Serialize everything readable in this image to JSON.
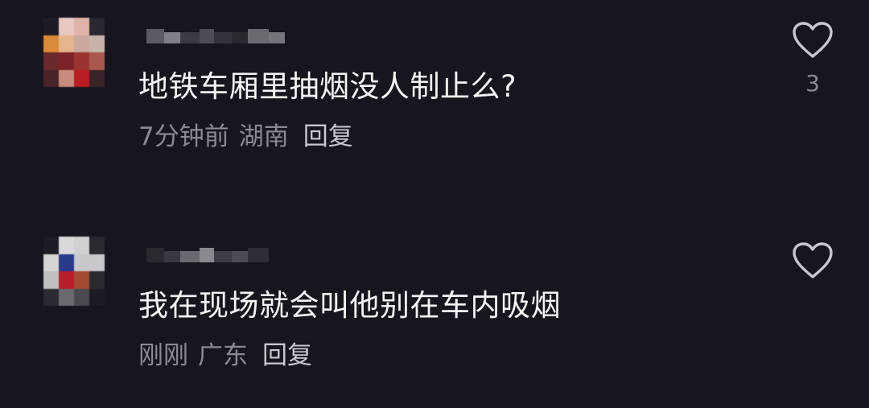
{
  "comments": [
    {
      "text": "地铁车厢里抽烟没人制止么?",
      "time": "7分钟前",
      "location": "湖南",
      "reply_label": "回复",
      "like_count": "3",
      "like_icon": "heart-outline-icon",
      "avatar_colors": [
        "#1d1b24",
        "#e7c9c2",
        "#e0b3a8",
        "#2a2730",
        "#d98a3a",
        "#e4b58c",
        "#c9a99d",
        "#c9b3ad",
        "#6a2a2d",
        "#7d2226",
        "#9a3430",
        "#a8584c",
        "#4a2428",
        "#c98b7d",
        "#b81d24",
        "#3a2428"
      ],
      "username_colors": [
        "#5c5b63",
        "#807f87",
        "#3c3b43",
        "#4d4c55",
        "#34333b",
        "#2a2930",
        "#6a6970",
        "#75747b"
      ]
    },
    {
      "text": "我在现场就会叫他别在车内吸烟",
      "time": "刚刚",
      "location": "广东",
      "reply_label": "回复",
      "like_count": "",
      "like_icon": "heart-outline-icon",
      "avatar_colors": [
        "#1d1b24",
        "#d9d8dc",
        "#cfcfd4",
        "#2a2930",
        "#d6d4d3",
        "#2a3a8a",
        "#c8c8cc",
        "#c9c8cc",
        "#c2c0bf",
        "#b61f2a",
        "#a34a35",
        "#2a2930",
        "#2c2b33",
        "#6a6a70",
        "#4a4950",
        "#1d1b24"
      ],
      "username_colors": [
        "#2a2930",
        "#3a3941",
        "#6a6970",
        "#8a8990",
        "#3d3c44",
        "#4c4b53",
        "#2f2e36"
      ]
    }
  ]
}
